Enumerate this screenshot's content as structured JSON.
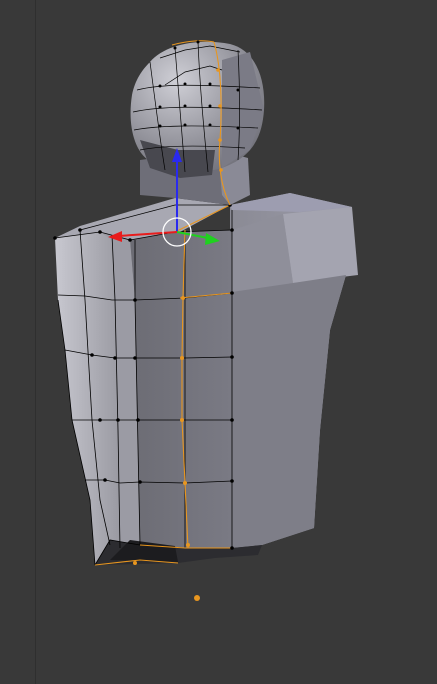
{
  "viewport": {
    "background": "#393939",
    "mode": "edit-mode",
    "shading": "solid",
    "mesh_color": "#8b8b93",
    "mesh_highlight": "#b9b9c4",
    "mesh_shadow": "#55555c",
    "wire_color": "#000000",
    "selected_edge_color": "#e8961f",
    "origin_color": "#e8961f"
  },
  "manipulator": {
    "x_axis_color": "#e81c1c",
    "y_axis_color": "#1fd11f",
    "z_axis_color": "#2a2aee",
    "pivot_ring_color": "#ffffff"
  },
  "icons": {
    "gizmo": "transform-manipulator-icon",
    "cursor": "3d-cursor-icon",
    "origin": "object-origin-icon"
  }
}
